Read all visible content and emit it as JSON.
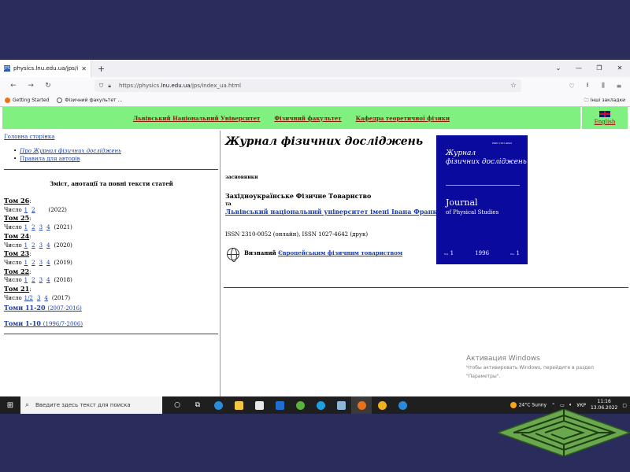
{
  "browser": {
    "tab_title": "physics.lnu.edu.ua/jps/index_u...",
    "tab_favicon": "JPS",
    "url_prefix": "https://physics.",
    "url_domain": "lnu.edu.ua",
    "url_path": "/jps/index_ua.html",
    "bookmarks": [
      "Getting Started",
      "Фізичний факультет ..."
    ],
    "other_bookmarks": "Інші закладки"
  },
  "header": {
    "links": [
      "Львівський Національний Університет",
      "Фізичний факультет",
      "Кафедра теоретичної фізики"
    ],
    "english": "English"
  },
  "left": {
    "home": "Головна сторінка",
    "about": "Про Журнал фізичних досліджень",
    "rules": "Правила для авторів",
    "contents_title": "Зміст, анотації та повні тексти статей",
    "volumes": [
      {
        "label": "Том 26",
        "issue_word": "Число",
        "issues": [
          "1",
          "2"
        ],
        "year": "(2022)"
      },
      {
        "label": "Том 25",
        "issue_word": "Число",
        "issues": [
          "1",
          "2",
          "3",
          "4"
        ],
        "year": "(2021)"
      },
      {
        "label": "Том 24",
        "issue_word": "Число",
        "issues": [
          "1",
          "2",
          "3",
          "4"
        ],
        "year": "(2020)"
      },
      {
        "label": "Том 23",
        "issue_word": "Число",
        "issues": [
          "1",
          "2",
          "3",
          "4"
        ],
        "year": "(2019)"
      },
      {
        "label": "Том 22",
        "issue_word": "Число",
        "issues": [
          "1",
          "2",
          "3",
          "4"
        ],
        "year": "(2018)"
      },
      {
        "label": "Том 21",
        "issue_word": "Число",
        "issues": [
          "1/2",
          "3",
          "4"
        ],
        "year": "(2017)"
      }
    ],
    "range1": "Томи 11-20",
    "range1_years": "(2007-2016)",
    "range2": "Томи 1-10",
    "range2_years": "(1996/7-2006)"
  },
  "right": {
    "journal_title": "Журнал фізичних досліджень",
    "founders": "засновники",
    "society": "Західноукраїнське Фізичне Товариство",
    "and": "та",
    "university": "Львівський національний університет імені Івана Франка",
    "issn": "ISSN 2310-0052 (онлайн), ISSN 1027-4642 (друк)",
    "recognized": "Визнаний",
    "eps": "Європейським фізичним товариством"
  },
  "cover": {
    "issn": "ISSN 1027-4642",
    "title_ua_1": "Журнал",
    "title_ua_2": "фізичних досліджень",
    "title_en_1": "Journal",
    "title_en_2": "of Physical Studies",
    "vol_label": "Vol.",
    "vol": "1",
    "year": "1996",
    "no_label": "No.",
    "no": "1"
  },
  "watermark": {
    "title": "Активация Windows",
    "line1": "Чтобы активировать Windows, перейдите в раздел",
    "line2": "\"Параметры\"."
  },
  "taskbar": {
    "search_placeholder": "Введите здесь текст для поиска",
    "temperature": "24°C",
    "weather": "Sunny",
    "lang": "УКР",
    "time": "11:16",
    "date": "13.06.2022"
  }
}
